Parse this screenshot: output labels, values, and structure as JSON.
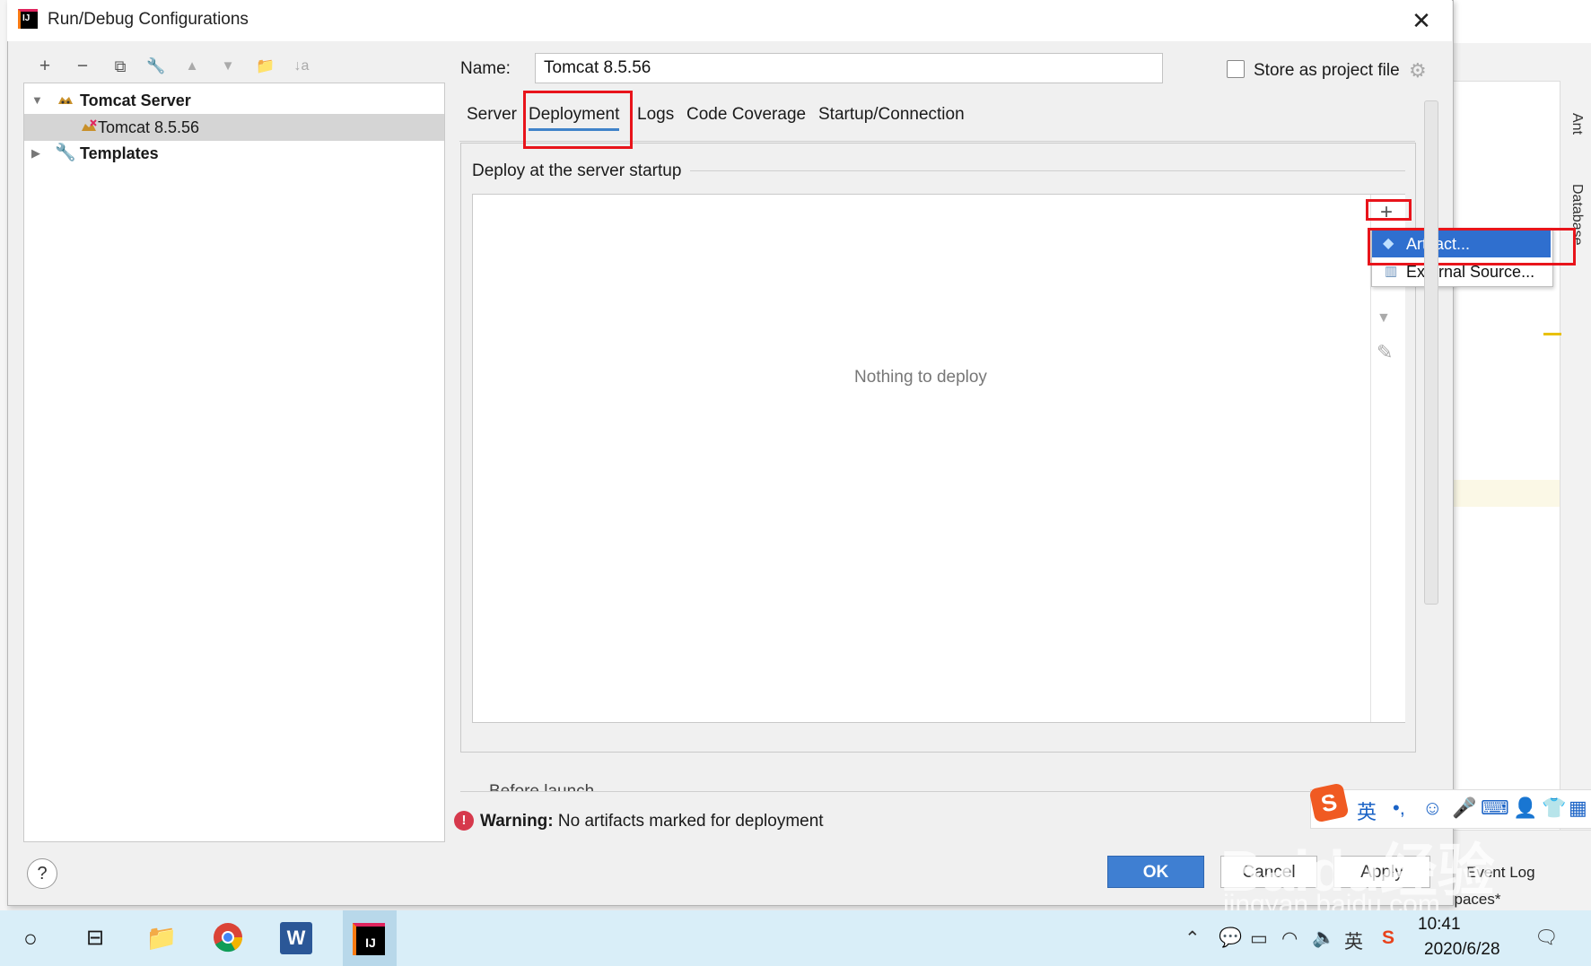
{
  "dialog": {
    "title": "Run/Debug Configurations",
    "close_glyph": "✕"
  },
  "toolbar": {
    "add": "+",
    "remove": "−",
    "copy": "⧉",
    "wrench": "🔧",
    "up": "▲",
    "down": "▼",
    "folder": "📁",
    "sort": "↓a"
  },
  "tree": {
    "group_label": "Tomcat Server",
    "child_label": "Tomcat 8.5.56",
    "templates_label": "Templates"
  },
  "name_field": {
    "label": "Name:",
    "value": "Tomcat 8.5.56"
  },
  "store_label": "Store as project file",
  "tabs": [
    "Server",
    "Deployment",
    "Logs",
    "Code Coverage",
    "Startup/Connection"
  ],
  "active_tab": "Deployment",
  "deploy": {
    "legend": "Deploy at the server startup",
    "empty_text": "Nothing to deploy",
    "add_glyph": "+"
  },
  "popup": {
    "artifact": "Artifact...",
    "external": "External Source..."
  },
  "before_launch": "Before launch",
  "warning": {
    "bold": "Warning:",
    "text": " No artifacts marked for deployment"
  },
  "buttons": {
    "help": "?",
    "ok": "OK",
    "cancel": "Cancel",
    "apply": "Apply"
  },
  "ide": {
    "ant": "Ant",
    "database": "Database",
    "event_log": "Event Log",
    "spaces": "spaces*"
  },
  "taskbar": {
    "time": "10:41",
    "date": "2020/6/28",
    "ime": "英"
  },
  "watermark": {
    "brand": "Baidu经验",
    "url": "jingyan.baidu.com"
  },
  "colors": {
    "accent": "#3f7fd2",
    "highlight_box": "#e8141b",
    "selection": "#2f6fcf"
  }
}
